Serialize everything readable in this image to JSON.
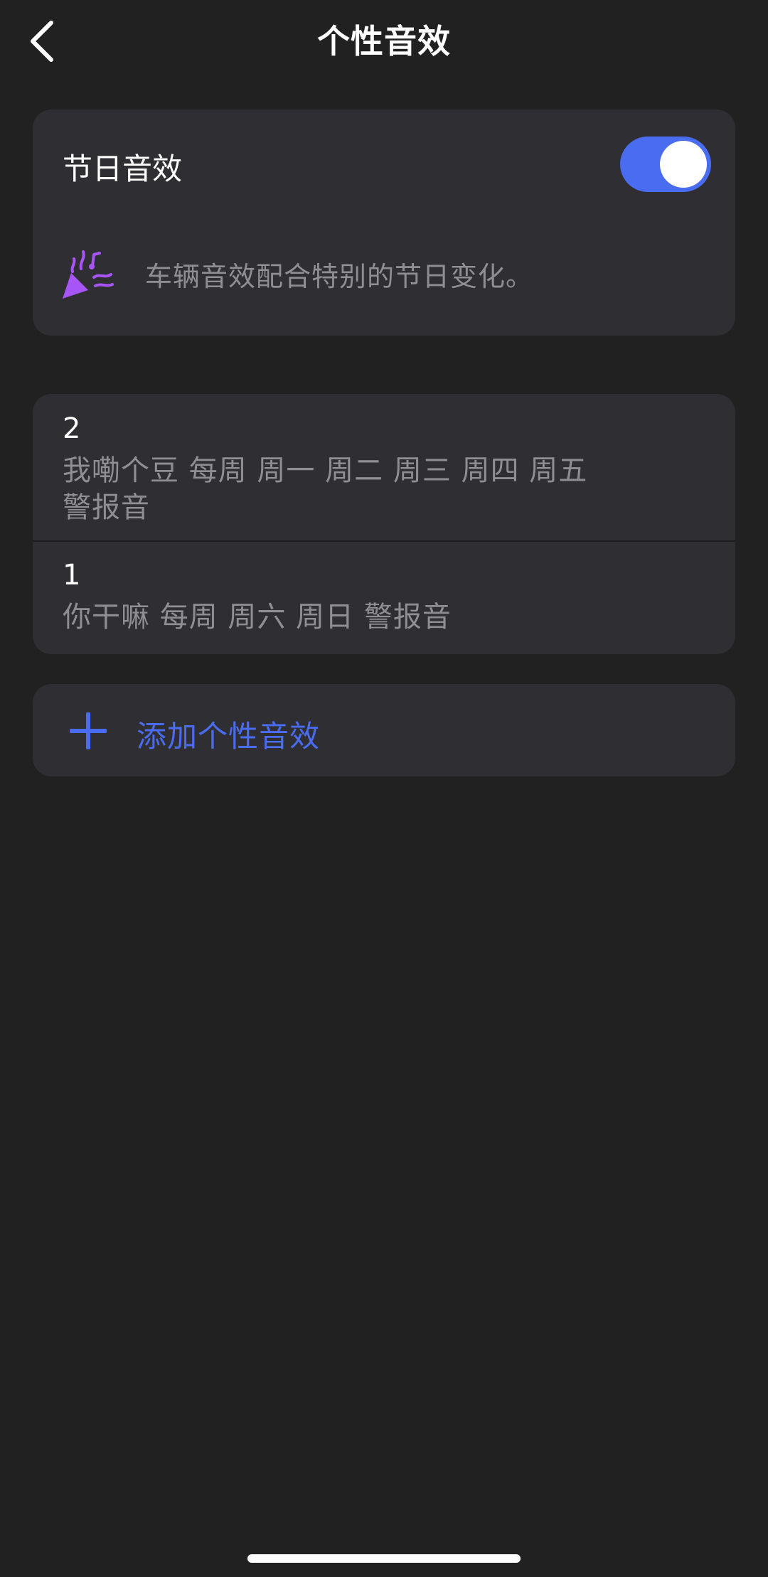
{
  "header": {
    "title": "个性音效",
    "back_icon": "chevron-left-icon"
  },
  "holiday": {
    "title": "节日音效",
    "toggle_on": true,
    "description": "车辆音效配合特别的节日变化。",
    "icon": "party-popper-icon",
    "icon_color": "#a855f7"
  },
  "sounds": [
    {
      "name": "2",
      "detail": "我嘞个豆 每周 周一 周二 周三 周四 周五 警报音"
    },
    {
      "name": "1",
      "detail": "你干嘛 每周 周六 周日 警报音"
    }
  ],
  "add": {
    "label": "添加个性音效",
    "icon": "plus-icon"
  },
  "colors": {
    "background": "#212121",
    "card": "#2f2f33",
    "accent": "#4a6cf0",
    "secondary_text": "#8e8e93"
  }
}
